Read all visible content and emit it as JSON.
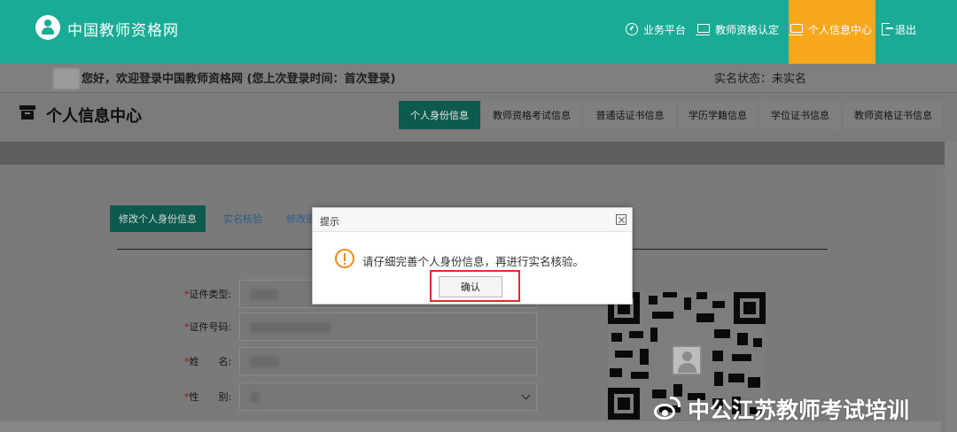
{
  "header": {
    "site_name": "中国教师资格网",
    "nav": [
      {
        "label": "业务平台",
        "icon": "dashboard-icon"
      },
      {
        "label": "教师资格认定",
        "icon": "monitor-icon"
      },
      {
        "label": "个人信息中心",
        "icon": "monitor-icon"
      },
      {
        "label": "退出",
        "icon": "sign-out-icon"
      }
    ],
    "colors": {
      "brand": "#1aab96",
      "active_nav": "#f7a81b"
    }
  },
  "welcome": {
    "text": "您好，欢迎登录中国教师资格网 (您上次登录时间：首次登录)",
    "realname_status": "实名状态：未实名"
  },
  "page_title": "个人信息中心",
  "tabs": [
    "个人身份信息",
    "教师资格考试信息",
    "普通话证书信息",
    "学历学籍信息",
    "学位证书信息",
    "教师资格证书信息"
  ],
  "subtabs": [
    "修改个人身份信息",
    "实名核验",
    "修改密"
  ],
  "form": {
    "fields": [
      {
        "label": "证件类型:"
      },
      {
        "label": "证件号码:"
      },
      {
        "label": "姓　　名:"
      },
      {
        "label": "性　　别:"
      }
    ]
  },
  "dialog": {
    "title": "提示",
    "message": "请仔细完善个人身份信息，再进行实名核验。",
    "confirm_label": "确认",
    "highlight_color": "#e22b2b"
  },
  "watermark": {
    "text": "中公江苏教师考试培训"
  }
}
